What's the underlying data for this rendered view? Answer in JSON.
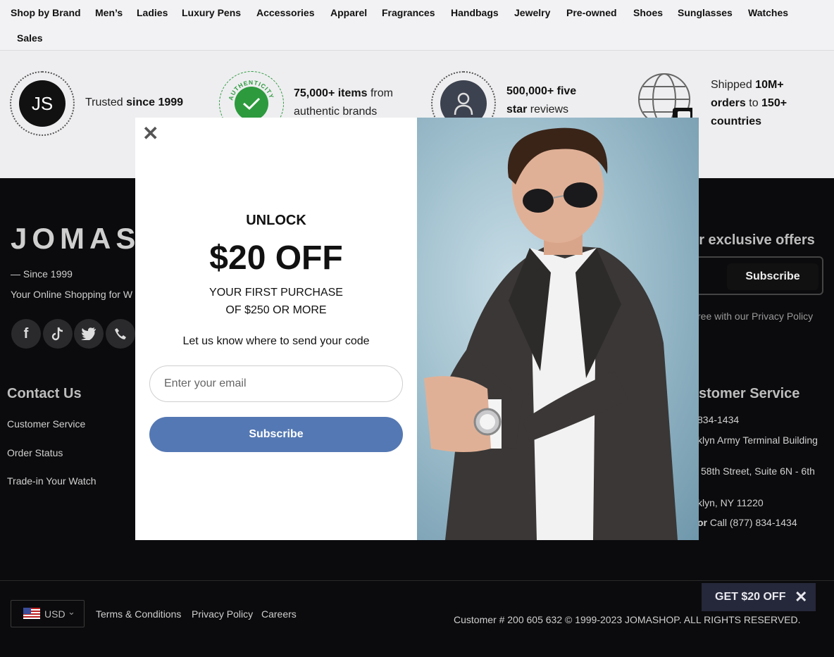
{
  "nav": {
    "items": [
      "Shop by Brand",
      "Men’s",
      "Ladies",
      "Luxury Pens",
      "Accessories",
      "Apparel",
      "Fragrances",
      "Handbags",
      "Jewelry",
      "Pre-owned",
      "Shoes",
      "Sunglasses",
      "Watches",
      "Sales"
    ]
  },
  "trust": {
    "badge_initials": "JS",
    "item1_pre": "Trusted ",
    "item1_bold": "since 1999",
    "item2_bold": "75,000+ items",
    "item2_rest": " from",
    "item2_line2": "authentic brands",
    "item3_bold": "500,000+ five",
    "item3_bold2": "star",
    "item3_rest": " reviews",
    "item4_pre": "Shipped ",
    "item4_bold": "10M+",
    "item4_bold2": "orders",
    "item4_mid": " to ",
    "item4_bold3": "150+",
    "item4_bold4": "countries",
    "badge2_text": "AUTHENTICITY"
  },
  "footer": {
    "logo": "JOMASHOP",
    "since": "— Since 1999",
    "tagline": "Your Online Shopping for W",
    "exclusive": "or exclusive offers",
    "subscribe": "Subscribe",
    "privacy_note": "ree with our Privacy Policy",
    "contact_heading": "Contact Us",
    "contact_links": [
      "Customer Service",
      "Order Status",
      "Trade-in Your Watch"
    ],
    "cs_heading": "stomer Service",
    "cs_lines": [
      "834-1434",
      "klyn Army Terminal Building",
      "58th Street, Suite 6N - 6th",
      "klyn, NY 11220"
    ],
    "cs_or": "or",
    "cs_call": " Call (877) 834-1434",
    "currency": "USD",
    "legal_links": [
      "Terms & Conditions",
      "Privacy Policy",
      "Careers"
    ],
    "copyright": "Customer # 200 605 632 © 1999-2023 JOMASHOP. ALL RIGHTS RESERVED.",
    "get20": "GET $20 OFF"
  },
  "modal": {
    "unlock": "UNLOCK",
    "offer": "$20 OFF",
    "line1": "YOUR FIRST PURCHASE",
    "line2": "OF $250 OR MORE",
    "prompt": "Let us know where to send your code",
    "email_placeholder": "Enter your email",
    "subscribe": "Subscribe"
  },
  "colors": {
    "subscribe_button": "#5478b3",
    "footer_bg": "#0b0b0d",
    "nav_bg": "#f2f2f4",
    "authenticity_green": "#2d9a3e"
  },
  "icons": [
    "close-icon",
    "facebook-icon",
    "tiktok-icon",
    "twitter-icon",
    "phone-icon",
    "globe-icon",
    "user-icon",
    "check-icon",
    "us-flag-icon",
    "chevron-down-icon"
  ]
}
